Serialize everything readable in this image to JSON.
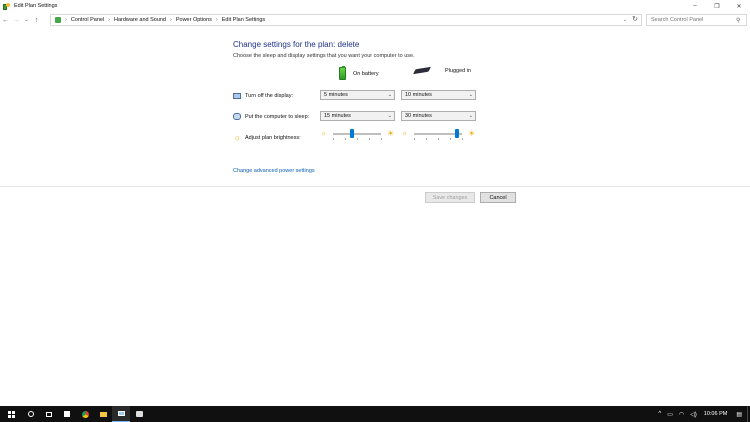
{
  "window": {
    "title": "Edit Plan Settings",
    "controls": {
      "minimize": "–",
      "maximize": "❐",
      "close": "✕"
    }
  },
  "nav": {
    "back": "←",
    "forward": "→",
    "recent": "⌄",
    "up": "↑",
    "breadcrumb": [
      "Control Panel",
      "Hardware and Sound",
      "Power Options",
      "Edit Plan Settings"
    ],
    "separator": "›",
    "dropdown": "⌄",
    "refresh": "↻",
    "search_placeholder": "Search Control Panel",
    "search_icon": "⚲"
  },
  "plan": {
    "heading": "Change settings for the plan: delete",
    "subheading": "Choose the sleep and display settings that you want your computer to use.",
    "columns": {
      "battery": "On battery",
      "plugged": "Plugged in"
    },
    "rows": {
      "display": {
        "label": "Turn off the display:",
        "battery": "5 minutes",
        "plugged": "10 minutes"
      },
      "sleep": {
        "label": "Put the computer to sleep:",
        "battery": "15 minutes",
        "plugged": "30 minutes"
      },
      "brightness": {
        "label": "Adjust plan brightness:",
        "battery_level": 0.4,
        "plugged_level": 0.9
      }
    },
    "select_arrow": "⌄",
    "advanced_link": "Change advanced power settings"
  },
  "buttons": {
    "save": "Save changes",
    "cancel": "Cancel"
  },
  "taskbar": {
    "items": [
      "start",
      "cortana",
      "task-view",
      "store",
      "chrome",
      "file-explorer",
      "control-panel",
      "network-app"
    ],
    "tray": {
      "chevron": "^",
      "battery": "▭",
      "wifi": "◠",
      "volume": "◁)",
      "clock": "10:06 PM",
      "notifications": "▤"
    }
  },
  "colors": {
    "accent": "#0078d7",
    "heading": "#1e3287",
    "link": "#0b5fb8",
    "taskbar": "#101010"
  }
}
